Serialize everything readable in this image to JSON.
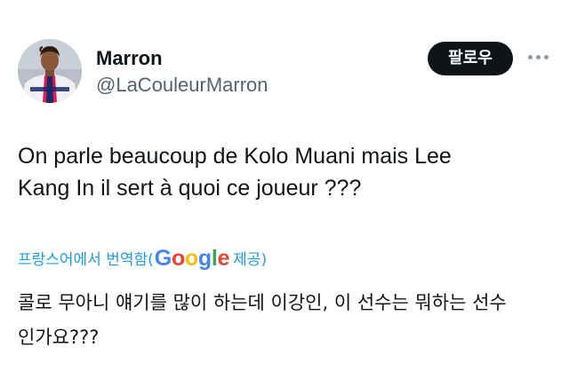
{
  "tweet": {
    "author": {
      "display_name": "Marron",
      "handle": "@LaCouleurMarron",
      "avatar_icon": "profile-photo-avatar"
    },
    "follow_button_label": "팔로우",
    "more_icon": "more-horizontal-icon",
    "text_lines": [
      "On parle beaucoup de Kolo Muani mais Lee",
      "Kang In il sert à quoi ce joueur ???"
    ],
    "translation": {
      "prefix": "프랑스어에서 번역함(",
      "google_letters": [
        "G",
        "o",
        "o",
        "g",
        "l",
        "e"
      ],
      "suffix": " 제공)",
      "text_lines": [
        "콜로 무아니 얘기를 많이 하는데 이강인, 이 선수는 뭐하는 선수",
        "인가요???"
      ]
    }
  },
  "colors": {
    "text_primary": "#0f1419",
    "text_secondary": "#536471",
    "accent_link": "#1d9bf0",
    "follow_button_bg": "#0f1419",
    "follow_button_text": "#ffffff",
    "google_blue": "#4285f4",
    "google_red": "#ea4335",
    "google_yellow": "#fbbc05",
    "google_green": "#34a853"
  }
}
